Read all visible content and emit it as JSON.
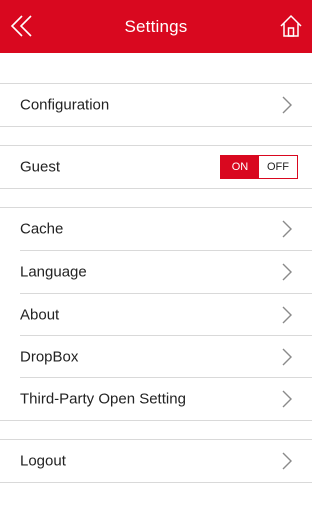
{
  "header": {
    "title": "Settings",
    "back_icon": "double-chevron-left-icon",
    "home_icon": "home-icon",
    "bg_color": "#d9081f"
  },
  "sections": [
    {
      "items": [
        {
          "label": "Configuration",
          "type": "link"
        }
      ]
    },
    {
      "items": [
        {
          "label": "Guest",
          "type": "toggle",
          "on_label": "ON",
          "off_label": "OFF",
          "state": "on"
        }
      ]
    },
    {
      "items": [
        {
          "label": "Cache",
          "type": "link"
        },
        {
          "label": "Language",
          "type": "link"
        },
        {
          "label": "About",
          "type": "link"
        },
        {
          "label": "DropBox",
          "type": "link"
        },
        {
          "label": "Third-Party Open Setting",
          "type": "link"
        }
      ]
    },
    {
      "items": [
        {
          "label": "Logout",
          "type": "link"
        }
      ]
    }
  ]
}
